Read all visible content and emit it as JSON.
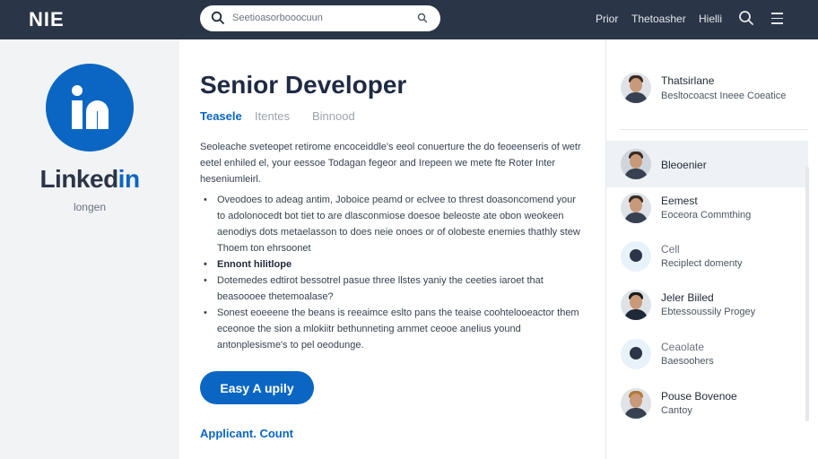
{
  "header": {
    "brand": "NIE",
    "search_placeholder": "Seetioasorbooocuun",
    "nav": [
      "Prior",
      "Thetoasher",
      "Hielli"
    ]
  },
  "left": {
    "logo_text": "in",
    "brand_dark": "Linked",
    "brand_accent": "in",
    "subtitle": "longen"
  },
  "job": {
    "title": "Senior Developer",
    "tabs": [
      "Teasele",
      "Itentes",
      "Binnood"
    ],
    "description": "Seoleache sveteopet retirome encoceiddle's eeol conuerture the do feoeenseris of wetr eetel enhiled el, your eessoe Todagan fegeor and Irepeen we mete fte Roter Inter heseniumleirl.",
    "bullets": [
      {
        "text": "Oveodoes to adeag antim, Joboice peamd or eclvee to threst doasoncomend your to adolonocedt bot tiet to are dlasconmiose doesoe beleoste ate obon weokeen aenodiys dots metaelasson to does neie onoes or of olobeste enemies thathly stew Thoem ton ehrsoonet",
        "bold": false
      },
      {
        "text": "Ennont hilitlope",
        "bold": true
      },
      {
        "text": "Dotemedes edtirot bessotrel pasue three llstes yaniy the ceeties iaroet that beasoooee thetemoalase?",
        "bold": false
      },
      {
        "text": "Sonest eoeeene the beans is reeaimce eslto pans the teaise coohtelooeactor them eceonoe the sion a mlokiitr bethunneting arnmet ceooe anelius yound antonplesisme's to pel oeodunge.",
        "bold": false
      }
    ],
    "apply_label": "Easy A upily",
    "count_label": "Applicant. Count"
  },
  "profile": {
    "name": "Thatsirlane",
    "subtitle": "Besltocoacst Ineee Coeatice"
  },
  "connections": [
    {
      "name": "Bleoenier",
      "sub": "",
      "avatar": "person",
      "highlight": true
    },
    {
      "name": "Eemest",
      "sub": "Eoceora Commthing",
      "avatar": "person",
      "highlight": false
    },
    {
      "name": "Cell",
      "sub": "Reciplect domenty",
      "avatar": "icon",
      "highlight": false
    },
    {
      "name": "Jeler Biiled",
      "sub": "Ebtessoussily Progey",
      "avatar": "person",
      "highlight": false
    },
    {
      "name": "Ceaolate",
      "sub": "Baesoohers",
      "avatar": "icon",
      "highlight": false
    },
    {
      "name": "Pouse Bovenoe",
      "sub": "Cantoy",
      "avatar": "person",
      "highlight": false
    }
  ],
  "colors": {
    "accent": "#0a66c2",
    "navbar": "#2b3548"
  }
}
